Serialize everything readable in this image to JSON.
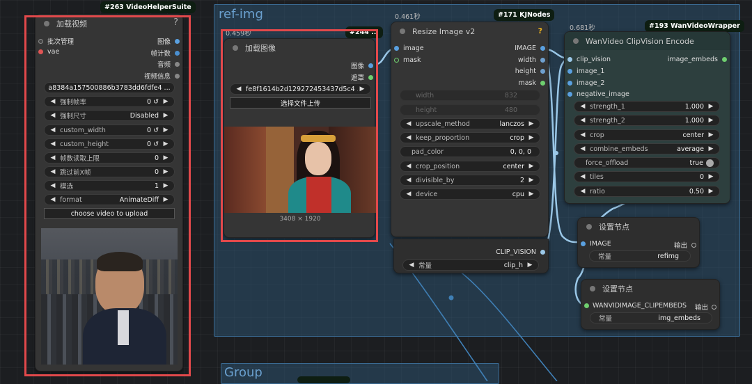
{
  "vhs": {
    "badge": "#263 VideoHelperSuite",
    "title": "加载视频",
    "help": "?",
    "inputs": [
      "批次管理",
      "vae"
    ],
    "outputs": [
      "图像",
      "帧计数",
      "音频",
      "视频信息"
    ],
    "filename": "a8384a157500886b3783dd6fdfe4 ...",
    "widgets": [
      {
        "label": "强制帧率",
        "value": "0 ↺"
      },
      {
        "label": "强制尺寸",
        "value": "Disabled"
      },
      {
        "label": "custom_width",
        "value": "0 ↺"
      },
      {
        "label": "custom_height",
        "value": "0 ↺"
      },
      {
        "label": "帧数读取上限",
        "value": "0"
      },
      {
        "label": "跳过前X帧",
        "value": "0"
      },
      {
        "label": "模选",
        "value": "1"
      },
      {
        "label": "format",
        "value": "AnimateDiff"
      }
    ],
    "upload_button": "choose video to upload"
  },
  "group_ref": {
    "title": "ref-img"
  },
  "group_bottom": {
    "title": "Group"
  },
  "load_image": {
    "time": "0.459秒",
    "badge": "#244 ...",
    "title": "加载图像",
    "outputs": [
      "图像",
      "遮罩"
    ],
    "filename": "fe8f1614b2d129272453437d5c4 ...",
    "upload_button": "选择文件上传",
    "dims": "3408 × 1920"
  },
  "resize": {
    "time": "0.461秒",
    "badge": "#171 KJNodes",
    "title": "Resize Image v2",
    "help": "?",
    "inputs": [
      "image",
      "mask"
    ],
    "outputs": [
      "IMAGE",
      "width",
      "height",
      "mask"
    ],
    "dim_widgets": [
      {
        "label": "width",
        "value": "832"
      },
      {
        "label": "height",
        "value": "480"
      }
    ],
    "widgets": [
      {
        "label": "upscale_method",
        "value": "lanczos"
      },
      {
        "label": "keep_proportion",
        "value": "crop"
      },
      {
        "label": "pad_color",
        "value": "0, 0, 0"
      },
      {
        "label": "crop_position",
        "value": "center"
      },
      {
        "label": "divisible_by",
        "value": "2"
      },
      {
        "label": "device",
        "value": "cpu"
      }
    ]
  },
  "clip_loader": {
    "output": "CLIP_VISION",
    "widget": {
      "label": "常量",
      "value": "clip_h"
    }
  },
  "wanvideo": {
    "time": "0.681秒",
    "badge": "#193 WanVideoWrapper",
    "title": "WanVideo ClipVision Encode",
    "inputs": [
      "clip_vision",
      "image_1",
      "image_2",
      "negative_image"
    ],
    "output": "image_embeds",
    "widgets": [
      {
        "label": "strength_1",
        "value": "1.000"
      },
      {
        "label": "strength_2",
        "value": "1.000"
      },
      {
        "label": "crop",
        "value": "center"
      },
      {
        "label": "combine_embeds",
        "value": "average"
      },
      {
        "label": "force_offload",
        "value": "true"
      },
      {
        "label": "tiles",
        "value": "0"
      },
      {
        "label": "ratio",
        "value": "0.50"
      }
    ]
  },
  "setnode1": {
    "title": "设置节点",
    "input": "IMAGE",
    "output": "输出",
    "widget": {
      "label": "常量",
      "value": "refimg"
    }
  },
  "setnode2": {
    "title": "设置节点",
    "input": "WANVIDIMAGE_CLIPEMBEDS",
    "output": "输出",
    "widget": {
      "label": "常量",
      "value": "img_embeds"
    }
  },
  "colors": {
    "highlight": "#e2494b",
    "group": "#2c506e",
    "link": "#9bc8e8"
  }
}
